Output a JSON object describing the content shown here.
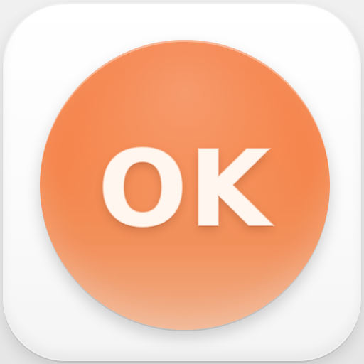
{
  "button": {
    "label": "OK"
  },
  "colors": {
    "accent": "#F47A3F",
    "label": "#FFF6EF",
    "tile": "#FFFFFF",
    "background": "#E9E9E9"
  }
}
